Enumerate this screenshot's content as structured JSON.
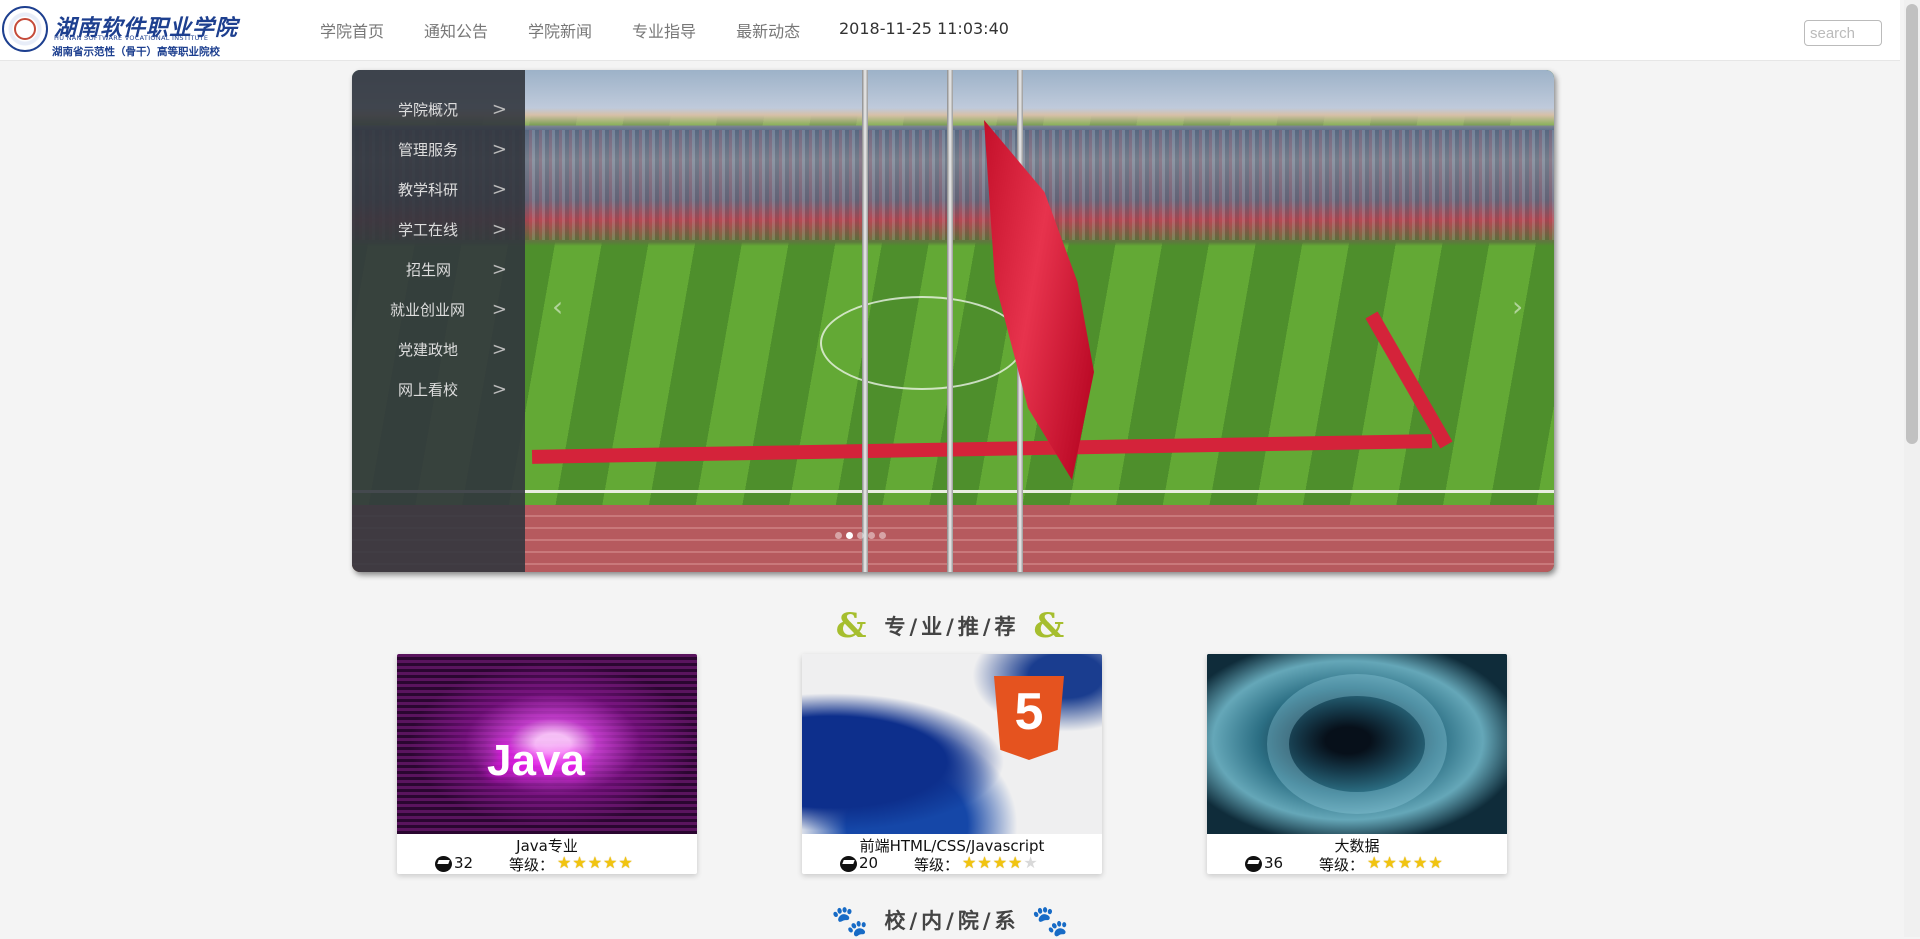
{
  "logo": {
    "cn": "湖南软件职业学院",
    "en": "HU NAN SOFTWARE VOCATIONAL INSTITUTE",
    "sub": "湖南省示范性（骨干）高等职业院校"
  },
  "nav": {
    "items": [
      "学院首页",
      "通知公告",
      "学院新闻",
      "专业指导",
      "最新动态"
    ],
    "clock": "2018-11-25 11:03:40"
  },
  "search": {
    "placeholder": "search"
  },
  "banner": {
    "menu": [
      "学院概况",
      "管理服务",
      "教学科研",
      "学工在线",
      "招生网",
      "就业创业网",
      "党建政地",
      "网上看校"
    ],
    "chevron": ">",
    "slide_count": 5,
    "active_slide": 2
  },
  "sections": {
    "recommend_title": "专/业/推/荐",
    "recommend_ornament": "&",
    "departments_title": "校/内/院/系",
    "departments_ornament": "🐾"
  },
  "courses": [
    {
      "title": "Java专业",
      "count": "32",
      "level_label": "等级：",
      "stars": 5,
      "thumb_text": "Java"
    },
    {
      "title": "前端HTML/CSS/Javascript",
      "count": "20",
      "level_label": "等级：",
      "stars": 4,
      "thumb_text": "5"
    },
    {
      "title": "大数据",
      "count": "36",
      "level_label": "等级：",
      "stars": 5,
      "thumb_text": ""
    }
  ],
  "colors": {
    "nav_text": "#777777",
    "ornament_amp": "#a6be2e",
    "ornament_paw": "#b86d2c",
    "star": "#f1c40f",
    "logo_blue": "#1d3f8f"
  }
}
